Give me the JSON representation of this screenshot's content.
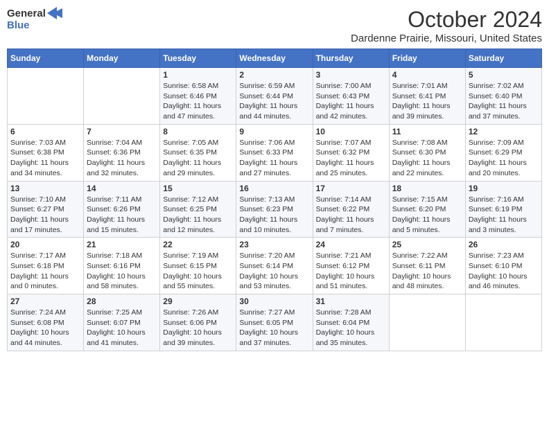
{
  "header": {
    "logo_line1": "General",
    "logo_line2": "Blue",
    "title": "October 2024",
    "subtitle": "Dardenne Prairie, Missouri, United States"
  },
  "days_of_week": [
    "Sunday",
    "Monday",
    "Tuesday",
    "Wednesday",
    "Thursday",
    "Friday",
    "Saturday"
  ],
  "weeks": [
    [
      {
        "day": "",
        "info": ""
      },
      {
        "day": "",
        "info": ""
      },
      {
        "day": "1",
        "info": "Sunrise: 6:58 AM\nSunset: 6:46 PM\nDaylight: 11 hours and 47 minutes."
      },
      {
        "day": "2",
        "info": "Sunrise: 6:59 AM\nSunset: 6:44 PM\nDaylight: 11 hours and 44 minutes."
      },
      {
        "day": "3",
        "info": "Sunrise: 7:00 AM\nSunset: 6:43 PM\nDaylight: 11 hours and 42 minutes."
      },
      {
        "day": "4",
        "info": "Sunrise: 7:01 AM\nSunset: 6:41 PM\nDaylight: 11 hours and 39 minutes."
      },
      {
        "day": "5",
        "info": "Sunrise: 7:02 AM\nSunset: 6:40 PM\nDaylight: 11 hours and 37 minutes."
      }
    ],
    [
      {
        "day": "6",
        "info": "Sunrise: 7:03 AM\nSunset: 6:38 PM\nDaylight: 11 hours and 34 minutes."
      },
      {
        "day": "7",
        "info": "Sunrise: 7:04 AM\nSunset: 6:36 PM\nDaylight: 11 hours and 32 minutes."
      },
      {
        "day": "8",
        "info": "Sunrise: 7:05 AM\nSunset: 6:35 PM\nDaylight: 11 hours and 29 minutes."
      },
      {
        "day": "9",
        "info": "Sunrise: 7:06 AM\nSunset: 6:33 PM\nDaylight: 11 hours and 27 minutes."
      },
      {
        "day": "10",
        "info": "Sunrise: 7:07 AM\nSunset: 6:32 PM\nDaylight: 11 hours and 25 minutes."
      },
      {
        "day": "11",
        "info": "Sunrise: 7:08 AM\nSunset: 6:30 PM\nDaylight: 11 hours and 22 minutes."
      },
      {
        "day": "12",
        "info": "Sunrise: 7:09 AM\nSunset: 6:29 PM\nDaylight: 11 hours and 20 minutes."
      }
    ],
    [
      {
        "day": "13",
        "info": "Sunrise: 7:10 AM\nSunset: 6:27 PM\nDaylight: 11 hours and 17 minutes."
      },
      {
        "day": "14",
        "info": "Sunrise: 7:11 AM\nSunset: 6:26 PM\nDaylight: 11 hours and 15 minutes."
      },
      {
        "day": "15",
        "info": "Sunrise: 7:12 AM\nSunset: 6:25 PM\nDaylight: 11 hours and 12 minutes."
      },
      {
        "day": "16",
        "info": "Sunrise: 7:13 AM\nSunset: 6:23 PM\nDaylight: 11 hours and 10 minutes."
      },
      {
        "day": "17",
        "info": "Sunrise: 7:14 AM\nSunset: 6:22 PM\nDaylight: 11 hours and 7 minutes."
      },
      {
        "day": "18",
        "info": "Sunrise: 7:15 AM\nSunset: 6:20 PM\nDaylight: 11 hours and 5 minutes."
      },
      {
        "day": "19",
        "info": "Sunrise: 7:16 AM\nSunset: 6:19 PM\nDaylight: 11 hours and 3 minutes."
      }
    ],
    [
      {
        "day": "20",
        "info": "Sunrise: 7:17 AM\nSunset: 6:18 PM\nDaylight: 11 hours and 0 minutes."
      },
      {
        "day": "21",
        "info": "Sunrise: 7:18 AM\nSunset: 6:16 PM\nDaylight: 10 hours and 58 minutes."
      },
      {
        "day": "22",
        "info": "Sunrise: 7:19 AM\nSunset: 6:15 PM\nDaylight: 10 hours and 55 minutes."
      },
      {
        "day": "23",
        "info": "Sunrise: 7:20 AM\nSunset: 6:14 PM\nDaylight: 10 hours and 53 minutes."
      },
      {
        "day": "24",
        "info": "Sunrise: 7:21 AM\nSunset: 6:12 PM\nDaylight: 10 hours and 51 minutes."
      },
      {
        "day": "25",
        "info": "Sunrise: 7:22 AM\nSunset: 6:11 PM\nDaylight: 10 hours and 48 minutes."
      },
      {
        "day": "26",
        "info": "Sunrise: 7:23 AM\nSunset: 6:10 PM\nDaylight: 10 hours and 46 minutes."
      }
    ],
    [
      {
        "day": "27",
        "info": "Sunrise: 7:24 AM\nSunset: 6:08 PM\nDaylight: 10 hours and 44 minutes."
      },
      {
        "day": "28",
        "info": "Sunrise: 7:25 AM\nSunset: 6:07 PM\nDaylight: 10 hours and 41 minutes."
      },
      {
        "day": "29",
        "info": "Sunrise: 7:26 AM\nSunset: 6:06 PM\nDaylight: 10 hours and 39 minutes."
      },
      {
        "day": "30",
        "info": "Sunrise: 7:27 AM\nSunset: 6:05 PM\nDaylight: 10 hours and 37 minutes."
      },
      {
        "day": "31",
        "info": "Sunrise: 7:28 AM\nSunset: 6:04 PM\nDaylight: 10 hours and 35 minutes."
      },
      {
        "day": "",
        "info": ""
      },
      {
        "day": "",
        "info": ""
      }
    ]
  ]
}
